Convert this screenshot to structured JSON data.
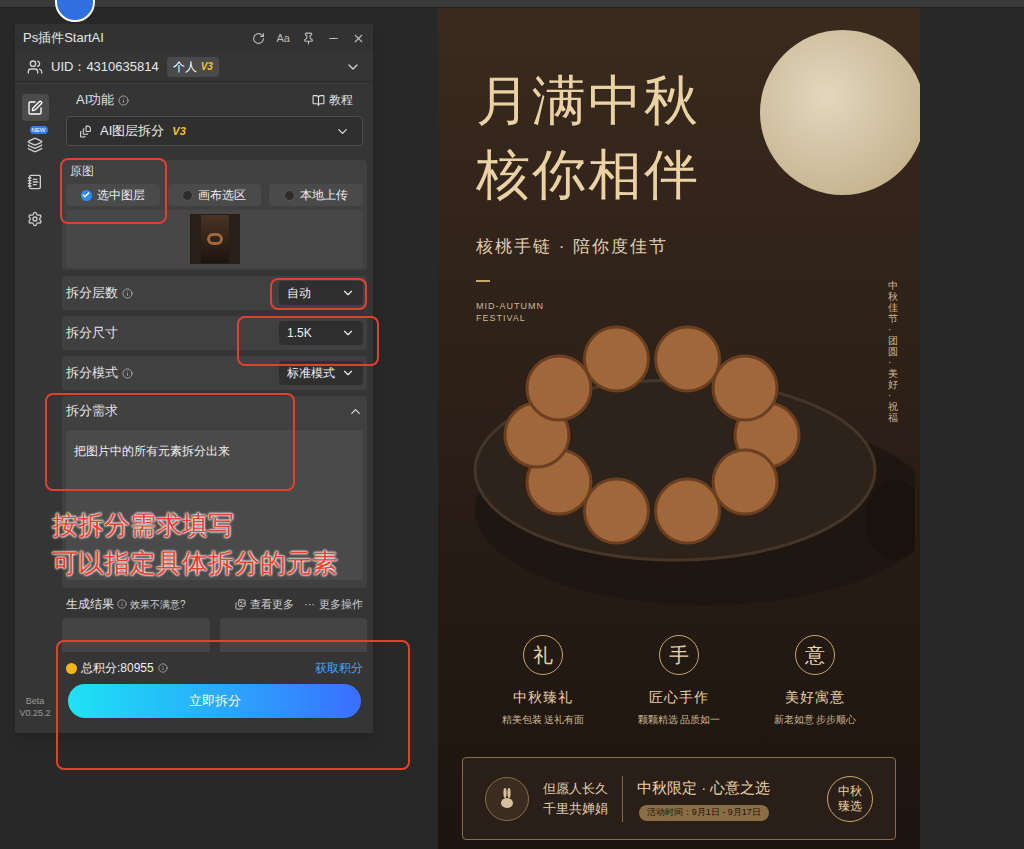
{
  "panel": {
    "title": "Ps插件StartAI",
    "text_button": "Aa",
    "uid": "UID：4310635814",
    "plan": "个人",
    "plan_badge": "V3",
    "sidebar": [
      {
        "selected": true
      },
      {
        "selected": false,
        "badge": "NEW"
      },
      {
        "selected": false
      },
      {
        "selected": false
      }
    ],
    "version": [
      "Beta",
      "V0.25.2"
    ],
    "function": {
      "label": "AI功能",
      "tutorial": "教程",
      "value": "AI图层拆分",
      "badge": "V3"
    },
    "source": {
      "label": "原图",
      "options": [
        {
          "label": "选中图层",
          "selected": true
        },
        {
          "label": "画布选区",
          "selected": false
        },
        {
          "label": "本地上传",
          "selected": false
        }
      ]
    },
    "settings": [
      {
        "label": "拆分层数",
        "info": true,
        "value": "自动"
      },
      {
        "label": "拆分尺寸",
        "info": false,
        "value": "1.5K"
      },
      {
        "label": "拆分模式",
        "info": true,
        "value": "标准模式"
      }
    ],
    "requirement": {
      "label": "拆分需求",
      "expanded": true,
      "text": "把图片中的所有元素拆分出来"
    },
    "results": {
      "label": "生成结果",
      "hint": "效果不满意?",
      "more": "查看更多",
      "actions_icon": "···",
      "actions": "更多操作"
    },
    "points": "总积分:80955",
    "get_points": "获取积分",
    "submit": "立即拆分"
  },
  "annotation": {
    "lines": [
      "按拆分需求填写",
      "可以指定具体拆分的元素"
    ]
  },
  "poster": {
    "title": [
      "月满中秋",
      "核你相伴"
    ],
    "subtitle": "核桃手链 · 陪你度佳节",
    "festival": [
      "MID-AUTUMN",
      "FESTIVAL"
    ],
    "side_text": "中秋佳节·团圆·美好·祝福",
    "features": [
      {
        "mark": "礼",
        "title": "中秋臻礼",
        "text": "精美包装 送礼有面"
      },
      {
        "mark": "手",
        "title": "匠心手作",
        "text": "颗颗精选 品质如一"
      },
      {
        "mark": "意",
        "title": "美好寓意",
        "text": "新老如意 步步顺心"
      }
    ],
    "footer": {
      "poem": [
        "但愿人长久",
        "千里共婵娟"
      ],
      "headline": "中秋限定 · 心意之选",
      "period": "活动时间：9月1日 - 9月17日",
      "seal": "中秋臻选"
    }
  }
}
